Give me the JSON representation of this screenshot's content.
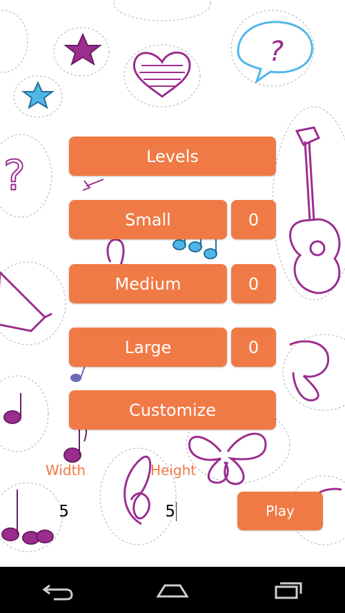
{
  "menu": {
    "levels_label": "Levels",
    "small_label": "Small",
    "small_count": "0",
    "medium_label": "Medium",
    "medium_count": "0",
    "large_label": "Large",
    "large_count": "0",
    "customize_label": "Customize"
  },
  "custom": {
    "width_label": "Width",
    "width_value": "5",
    "height_label": "Height",
    "height_value": "5",
    "play_label": "Play"
  },
  "colors": {
    "accent": "#f07a45",
    "doodle_purple": "#9b2d8f",
    "doodle_blue": "#4fb6e8",
    "navbar": "#000000"
  },
  "navbar": {
    "icons": [
      "back-icon",
      "home-icon",
      "recent-apps-icon"
    ]
  }
}
